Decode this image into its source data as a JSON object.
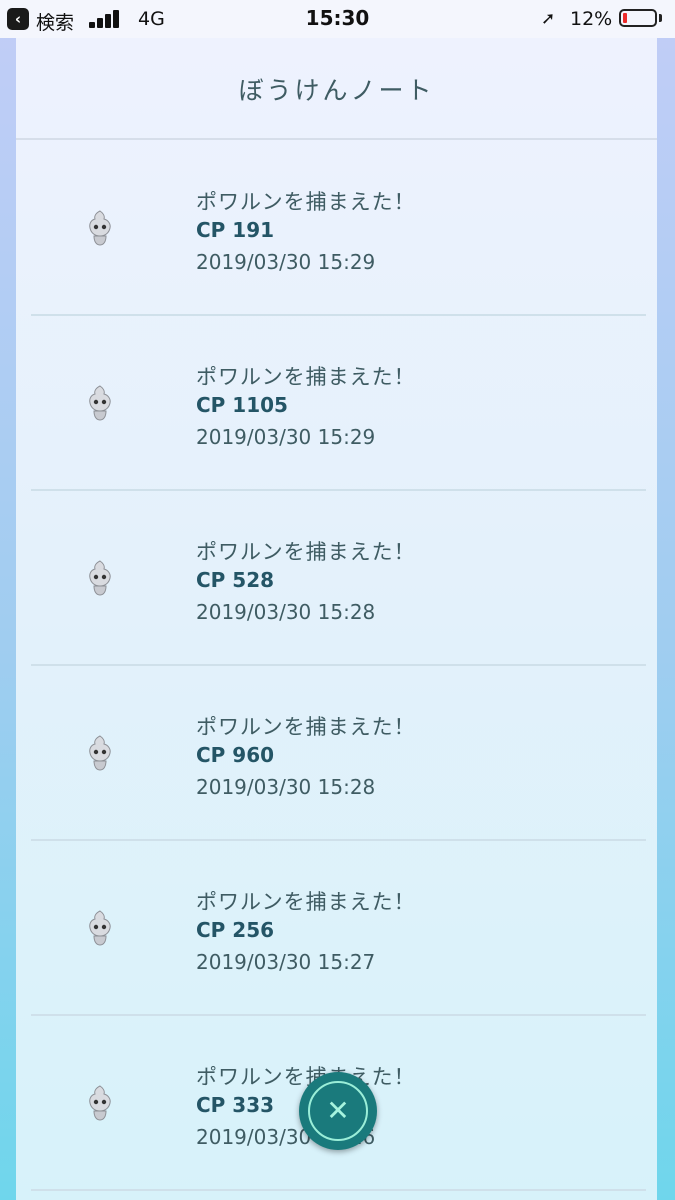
{
  "status_bar": {
    "back_label": "検索",
    "network": "4G",
    "time": "15:30",
    "battery_percent_label": "12%",
    "battery_level": 0.12,
    "battery_color": "#ec2b2b"
  },
  "header": {
    "title": "ぼうけんノート"
  },
  "entries": [
    {
      "title": "ポワルンを捕まえた！",
      "cp": "CP 191",
      "date": "2019/03/30 15:29",
      "icon": "castform-icon"
    },
    {
      "title": "ポワルンを捕まえた！",
      "cp": "CP 1105",
      "date": "2019/03/30 15:29",
      "icon": "castform-icon"
    },
    {
      "title": "ポワルンを捕まえた！",
      "cp": "CP 528",
      "date": "2019/03/30 15:28",
      "icon": "castform-icon"
    },
    {
      "title": "ポワルンを捕まえた！",
      "cp": "CP 960",
      "date": "2019/03/30 15:28",
      "icon": "castform-icon"
    },
    {
      "title": "ポワルンを捕まえた！",
      "cp": "CP 256",
      "date": "2019/03/30 15:27",
      "icon": "castform-icon"
    },
    {
      "title": "ポワルンを捕まえた！",
      "cp": "CP 333",
      "date": "2019/03/30 15:26",
      "icon": "castform-icon"
    }
  ],
  "close_button": {
    "icon": "close-icon",
    "glyph": "✕"
  }
}
